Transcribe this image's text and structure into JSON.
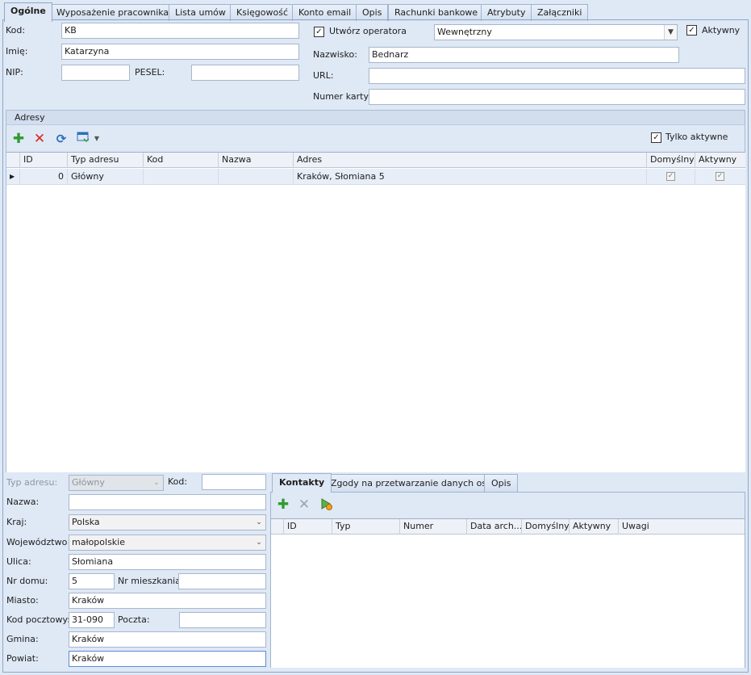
{
  "tabs": [
    "Ogólne",
    "Wyposażenie pracownika",
    "Lista umów",
    "Księgowość",
    "Konto email",
    "Opis",
    "Rachunki bankowe",
    "Atrybuty",
    "Załączniki"
  ],
  "general": {
    "kod_label": "Kod:",
    "kod_value": "KB",
    "imie_label": "Imię:",
    "imie_value": "Katarzyna",
    "nip_label": "NIP:",
    "nip_value": "",
    "pesel_label": "PESEL:",
    "pesel_value": "",
    "create_operator_label": "Utwórz operatora",
    "operator_type": "Wewnętrzny",
    "active_label": "Aktywny",
    "nazwisko_label": "Nazwisko:",
    "nazwisko_value": "Bednarz",
    "url_label": "URL:",
    "url_value": "",
    "card_label": "Numer karty:",
    "card_value": ""
  },
  "addresses": {
    "title": "Adresy",
    "only_active_label": "Tylko aktywne",
    "columns": [
      "ID",
      "Typ adresu",
      "Kod",
      "Nazwa",
      "Adres",
      "Domyślny",
      "Aktywny"
    ],
    "rows": [
      {
        "id": "0",
        "type": "Główny",
        "kod": "",
        "nazwa": "",
        "adres": "Kraków, Słomiana 5",
        "default": true,
        "active": true
      }
    ]
  },
  "address_form": {
    "type_label": "Typ adresu:",
    "type_value": "Główny",
    "kod_label": "Kod:",
    "kod_value": "",
    "nazwa_label": "Nazwa:",
    "nazwa_value": "",
    "kraj_label": "Kraj:",
    "kraj_value": "Polska",
    "woj_label": "Województwo",
    "woj_value": "małopolskie",
    "ulica_label": "Ulica:",
    "ulica_value": "Słomiana",
    "nr_domu_label": "Nr domu:",
    "nr_domu_value": "5",
    "nr_mieszkania_label": "Nr mieszkania:",
    "nr_mieszkania_value": "",
    "miasto_label": "Miasto:",
    "miasto_value": "Kraków",
    "kod_pocztowy_label": "Kod pocztowy:",
    "kod_pocztowy_value": "31-090",
    "poczta_label": "Poczta:",
    "poczta_value": "",
    "gmina_label": "Gmina:",
    "gmina_value": "Kraków",
    "powiat_label": "Powiat:",
    "powiat_value": "Kraków"
  },
  "contacts": {
    "tabs": [
      "Kontakty",
      "Zgody na przetwarzanie danych os.",
      "Opis"
    ],
    "columns": [
      "ID",
      "Typ",
      "Numer",
      "Data arch...",
      "Domyślny",
      "Aktywny",
      "Uwagi"
    ]
  }
}
